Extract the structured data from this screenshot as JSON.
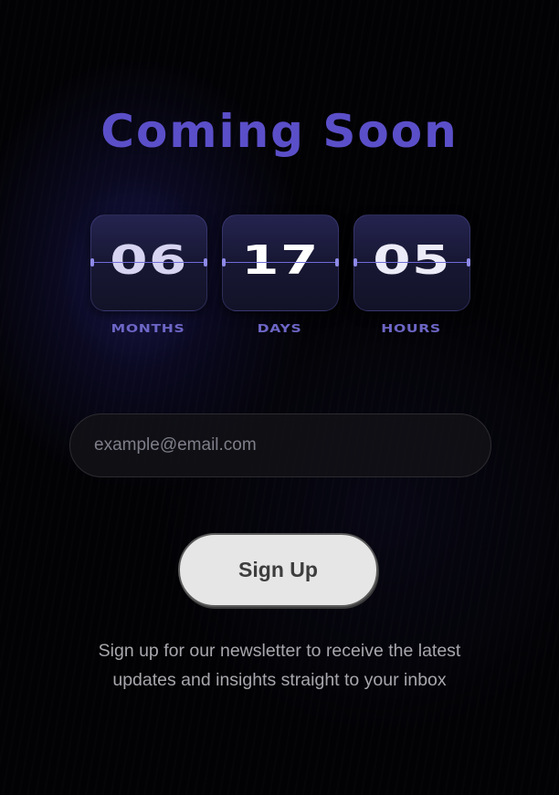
{
  "title": "Coming Soon",
  "countdown": [
    {
      "value": "06",
      "unit": "MONTHS"
    },
    {
      "value": "17",
      "unit": "DAYS"
    },
    {
      "value": "05",
      "unit": "HOURS"
    }
  ],
  "form": {
    "email_placeholder": "example@email.com",
    "email_value": "",
    "submit_label": "Sign Up"
  },
  "description": {
    "line1": "Sign up for our newsletter to receive the latest",
    "line2": "updates and insights straight to your inbox"
  },
  "colors": {
    "accent": "#5b4fc9",
    "background": "#020204",
    "button": "#e6e6e6",
    "text_muted": "#a7a7ad"
  }
}
